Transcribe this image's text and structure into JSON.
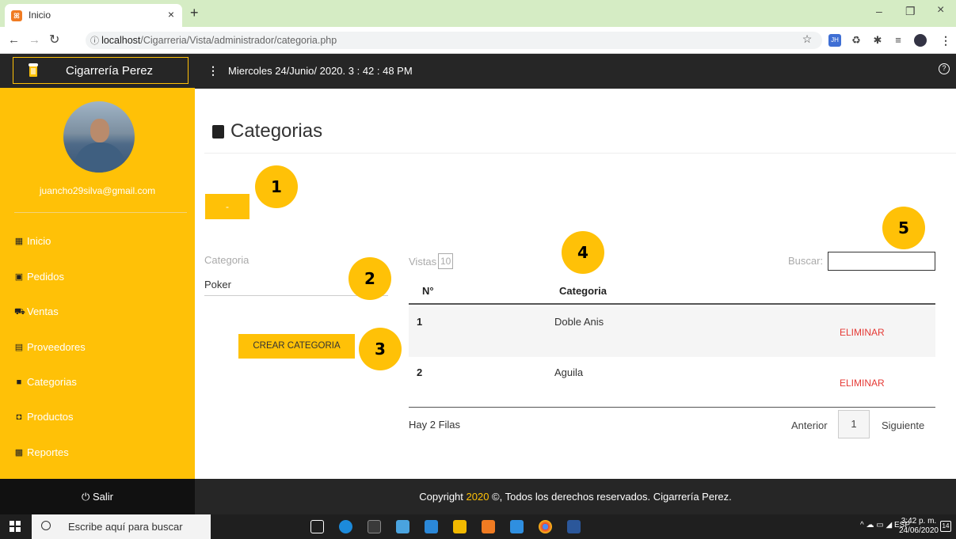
{
  "browser": {
    "tab_title": "Inicio",
    "tab_close": "×",
    "new_tab": "+",
    "url_host": "localhost",
    "url_path": "/Cigarreria/Vista/administrador/categoria.php",
    "win_min": "–",
    "win_max": "❐",
    "win_close": "×"
  },
  "app": {
    "brand": "Cigarrería Perez",
    "datetime": "Miercoles 24/Junio/ 2020. 3 : 42 : 48 PM",
    "email": "juancho29silva@gmail.com",
    "sidebar": [
      {
        "label": "Inicio",
        "icon": "grid-icon"
      },
      {
        "label": "Pedidos",
        "icon": "clipboard-icon"
      },
      {
        "label": "Ventas",
        "icon": "cart-icon"
      },
      {
        "label": "Proveedores",
        "icon": "truck-icon"
      },
      {
        "label": "Categorias",
        "icon": "book-icon"
      },
      {
        "label": "Productos",
        "icon": "bag-icon"
      },
      {
        "label": "Reportes",
        "icon": "chart-icon"
      }
    ],
    "logout": "Salir"
  },
  "main": {
    "title": "Categorias",
    "small_button": "-",
    "form": {
      "label": "Categoria",
      "value": "Poker",
      "create_button": "CREAR CATEGORIA"
    },
    "table": {
      "vistas_label": "Vistas",
      "vistas_value": "10",
      "search_label": "Buscar:",
      "headers": [
        "N°",
        "Categoria"
      ],
      "rows": [
        {
          "n": "1",
          "categoria": "Doble Anis",
          "action": "ELIMINAR"
        },
        {
          "n": "2",
          "categoria": "Aguila",
          "action": "ELIMINAR"
        }
      ],
      "summary": "Hay 2 Filas",
      "prev": "Anterior",
      "page": "1",
      "next": "Siguiente"
    },
    "badges": [
      "1",
      "2",
      "3",
      "4",
      "5"
    ]
  },
  "footer": {
    "prefix": "Copyright ",
    "year": "2020",
    "suffix": " ©, Todos los derechos reservados. Cigarrería Perez."
  },
  "taskbar": {
    "search_placeholder": "Escribe aquí para buscar",
    "lang": "ESP",
    "time": "3:42 p. m.",
    "date": "24/06/2020",
    "notifications": "14"
  },
  "colors": {
    "accent": "#ffc107",
    "dark": "#262626",
    "danger": "#e53935"
  }
}
